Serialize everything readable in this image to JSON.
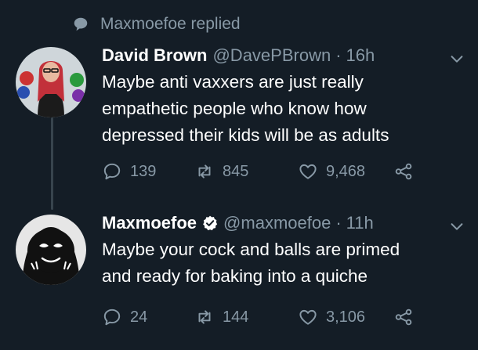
{
  "context": {
    "text": "Maxmoefoe replied"
  },
  "tweets": [
    {
      "name": "David Brown",
      "handle": "@DavePBrown",
      "separator": "·",
      "time": "16h",
      "text": "Maybe anti vaxxers are just really\nempathetic people who know how\ndepressed their kids will be as adults",
      "replies": "139",
      "retweets": "845",
      "likes": "9,468",
      "verified": false
    },
    {
      "name": "Maxmoefoe",
      "handle": "@maxmoefoe",
      "separator": "·",
      "time": "11h",
      "text": "Maybe your cock and balls are primed\nand ready for baking into a quiche",
      "replies": "24",
      "retweets": "144",
      "likes": "3,106",
      "verified": true
    }
  ],
  "colors": {
    "background": "#141d26",
    "text": "#ffffff",
    "muted": "#8899a6",
    "thread_line": "#38444d"
  }
}
